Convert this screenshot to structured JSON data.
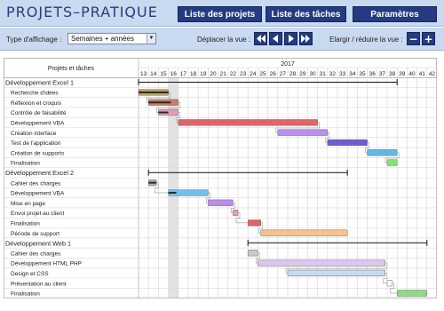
{
  "header": {
    "title": "PROJETS–PRATIQUE",
    "nav": [
      {
        "label": "Liste des projets"
      },
      {
        "label": "Liste des tâches"
      },
      {
        "label": "Paramètres"
      }
    ]
  },
  "controls": {
    "display_type_label": "Type d'affichage :",
    "display_type_value": "Semaines + années",
    "move_view_label": "Déplacer la vue :",
    "zoom_label": "Elargir / réduire la vue :",
    "zoom_out": "−",
    "zoom_in": "+"
  },
  "gantt": {
    "column_header": "Projets et tâches",
    "year": "2017",
    "weeks": [
      "13",
      "14",
      "15",
      "16",
      "17",
      "18",
      "19",
      "20",
      "21",
      "22",
      "23",
      "24",
      "25",
      "26",
      "27",
      "28",
      "29",
      "30",
      "31",
      "32",
      "33",
      "34",
      "35",
      "36",
      "37",
      "38",
      "39",
      "40",
      "41",
      "42"
    ],
    "highlight_week": "16",
    "projects": [
      {
        "name": "Développement Excel 1",
        "span": [
          13,
          39
        ],
        "tasks": [
          {
            "name": "Recherche d'idées",
            "start": 13,
            "end": 16,
            "color": "#b7a36a",
            "progress": 1.0
          },
          {
            "name": "Réflexion et croquis",
            "start": 14,
            "end": 17,
            "color": "#c77d6a",
            "progress": 0.75
          },
          {
            "name": "Contrôle de faisabilité",
            "start": 15,
            "end": 17,
            "color": "#e79ab8",
            "progress": 0.5
          },
          {
            "name": "Développement VBA",
            "start": 17,
            "end": 31,
            "color": "#e0646b",
            "progress": 0
          },
          {
            "name": "Création interface",
            "start": 27,
            "end": 32,
            "color": "#b890e6",
            "progress": 0
          },
          {
            "name": "Test de l'application",
            "start": 32,
            "end": 36,
            "color": "#6b5fd1",
            "progress": 0
          },
          {
            "name": "Création de supports",
            "start": 36,
            "end": 39,
            "color": "#5fb8e8",
            "progress": 0
          },
          {
            "name": "Finalisation",
            "start": 38,
            "end": 39,
            "color": "#86df79",
            "progress": 0
          }
        ]
      },
      {
        "name": "Développement Excel 2",
        "span": [
          14,
          34
        ],
        "tasks": [
          {
            "name": "Cahier des charges",
            "start": 14,
            "end": 14.8,
            "color": "#b0b0b0",
            "progress": 1.0
          },
          {
            "name": "Développement VBA",
            "start": 16,
            "end": 20,
            "color": "#6cc2ec",
            "progress": 0.2
          },
          {
            "name": "Mise en page",
            "start": 20,
            "end": 22.5,
            "color": "#b890e6",
            "progress": 0
          },
          {
            "name": "Envoi projet au client",
            "start": 22.5,
            "end": 23,
            "color": "#e79ab8",
            "progress": 0
          },
          {
            "name": "Finalisation",
            "start": 24,
            "end": 25.3,
            "color": "#e0646b",
            "progress": 0
          },
          {
            "name": "Période de support",
            "start": 25.3,
            "end": 34,
            "color": "#f6c28e",
            "progress": 0
          }
        ]
      },
      {
        "name": "Développement Web 1",
        "span": [
          24,
          42
        ],
        "tasks": [
          {
            "name": "Cahier des charges",
            "start": 24,
            "end": 25,
            "color": "#c8c8c8",
            "progress": 0
          },
          {
            "name": "Développement HTML PHP",
            "start": 25,
            "end": 37.8,
            "color": "#dcc7f0",
            "progress": 0
          },
          {
            "name": "Design et CSS",
            "start": 28,
            "end": 37.8,
            "color": "#c9d9f2",
            "progress": 0
          },
          {
            "name": "Présentation au client",
            "start": 38,
            "end": 38.5,
            "color": "#ffffff",
            "progress": 0
          },
          {
            "name": "Finalisation",
            "start": 39,
            "end": 42,
            "color": "#86df79",
            "progress": 0
          }
        ]
      }
    ]
  }
}
